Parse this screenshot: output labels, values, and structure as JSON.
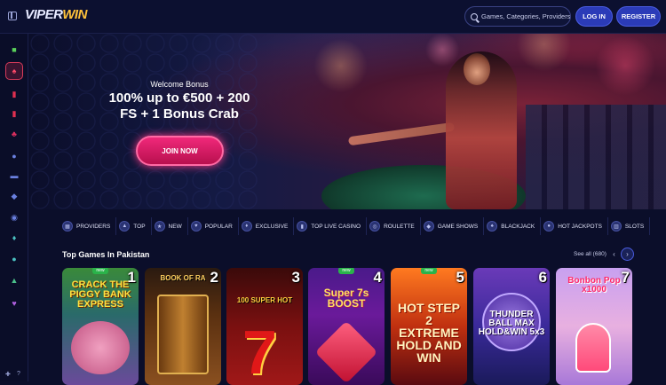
{
  "header": {
    "logo_part1": "VIPER",
    "logo_part2": "WIN",
    "search_placeholder": "Games, Categories, Providers",
    "login_label": "LOG IN",
    "register_label": "REGISTER"
  },
  "sidebar": {
    "icons": [
      "gift-icon",
      "casino-icon",
      "slots-icon",
      "live-icon",
      "poker-icon",
      "sports-icon",
      "tv-icon",
      "gamepad-icon",
      "pin-icon",
      "diamond-icon",
      "crypto-icon",
      "lock-icon",
      "vip-icon"
    ]
  },
  "hero": {
    "subtitle": "Welcome Bonus",
    "title_line1": "100% up to €500 + 200",
    "title_line2": "FS + 1 Bonus Crab",
    "cta_label": "JOIN NOW"
  },
  "categories": [
    {
      "label": "PROVIDERS",
      "icon": "providers-icon"
    },
    {
      "label": "TOP",
      "icon": "top-icon"
    },
    {
      "label": "NEW",
      "icon": "new-icon"
    },
    {
      "label": "POPULAR",
      "icon": "popular-icon"
    },
    {
      "label": "EXCLUSIVE",
      "icon": "exclusive-icon"
    },
    {
      "label": "TOP LIVE CASINO",
      "icon": "live-casino-icon"
    },
    {
      "label": "ROULETTE",
      "icon": "roulette-icon"
    },
    {
      "label": "GAME SHOWS",
      "icon": "game-shows-icon"
    },
    {
      "label": "BLACKJACK",
      "icon": "blackjack-icon"
    },
    {
      "label": "HOT JACKPOTS",
      "icon": "jackpot-icon"
    },
    {
      "label": "SLOTS",
      "icon": "slots-icon"
    }
  ],
  "top_games": {
    "title": "Top Games In Pakistan",
    "see_all": "See all (680)",
    "new_badge": "new",
    "games": [
      {
        "rank": "1",
        "title": "CRACK THE PIGGY BANK EXPRESS",
        "new": true
      },
      {
        "rank": "2",
        "title": "BOOK OF RA",
        "new": false
      },
      {
        "rank": "3",
        "title": "100 SUPER HOT",
        "new": false
      },
      {
        "rank": "4",
        "title": "Super 7s BOOST",
        "new": true
      },
      {
        "rank": "5",
        "title": "HOT STEP 2 EXTREME HOLD AND WIN",
        "new": true
      },
      {
        "rank": "6",
        "title": "THUNDER BALL MAX HOLD&WIN 5x3",
        "new": false
      },
      {
        "rank": "7",
        "title": "Bonbon Pop x1000",
        "new": false
      }
    ]
  },
  "colors": {
    "background": "#0b0e2a",
    "accent_pink": "#f0287a",
    "accent_blue": "#2b3bb8",
    "logo_gold": "#ffc23a"
  }
}
